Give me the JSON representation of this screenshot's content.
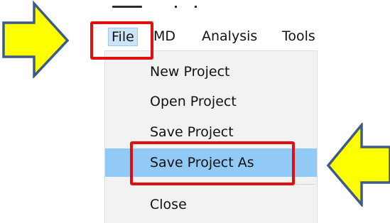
{
  "menubar": {
    "items": [
      {
        "label": "File",
        "active": true
      },
      {
        "label": "MD",
        "active": false
      },
      {
        "label": "Analysis",
        "active": false
      },
      {
        "label": "Tools",
        "active": false
      }
    ]
  },
  "file_menu": {
    "items": [
      {
        "label": "New Project",
        "highlighted": false
      },
      {
        "label": "Open Project",
        "highlighted": false
      },
      {
        "label": "Save Project",
        "highlighted": false
      },
      {
        "label": "Save Project As",
        "highlighted": true
      },
      {
        "label": "Close",
        "highlighted": false
      }
    ]
  },
  "annotations": {
    "box_color": "#e01010",
    "arrow_fill": "#ffff00",
    "arrow_outline": "#3d5a8a",
    "highlight_color": "#91c9f7"
  },
  "icons": [
    "right-arrow-annotation-icon",
    "left-arrow-annotation-icon"
  ]
}
